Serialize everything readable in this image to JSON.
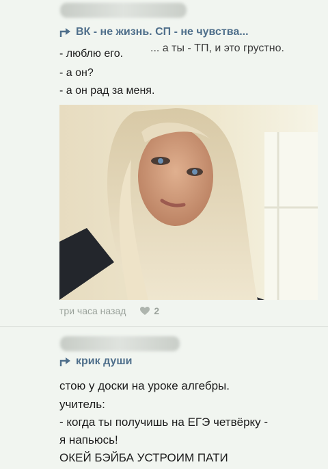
{
  "post1": {
    "repost_title": "ВК - не жизнь. СП - не чувства...",
    "lines": [
      "- люблю его.",
      "- а он?",
      "- а он рад за меня."
    ],
    "side_note": "... а ты - ТП, и это грустно.",
    "time": "три часа назад",
    "likes": "2"
  },
  "post2": {
    "repost_title": "крик души",
    "lines": [
      "стою у доски на уроке алгебры.",
      "учитель:",
      "- когда ты получишь на ЕГЭ четвёрку -",
      "я напьюсь!",
      "ОКЕЙ БЭЙБА УСТРОИМ ПАТИ"
    ]
  },
  "colors": {
    "link": "#4f6f8b",
    "meta": "#9aa29b",
    "background": "#f1f5f0"
  }
}
